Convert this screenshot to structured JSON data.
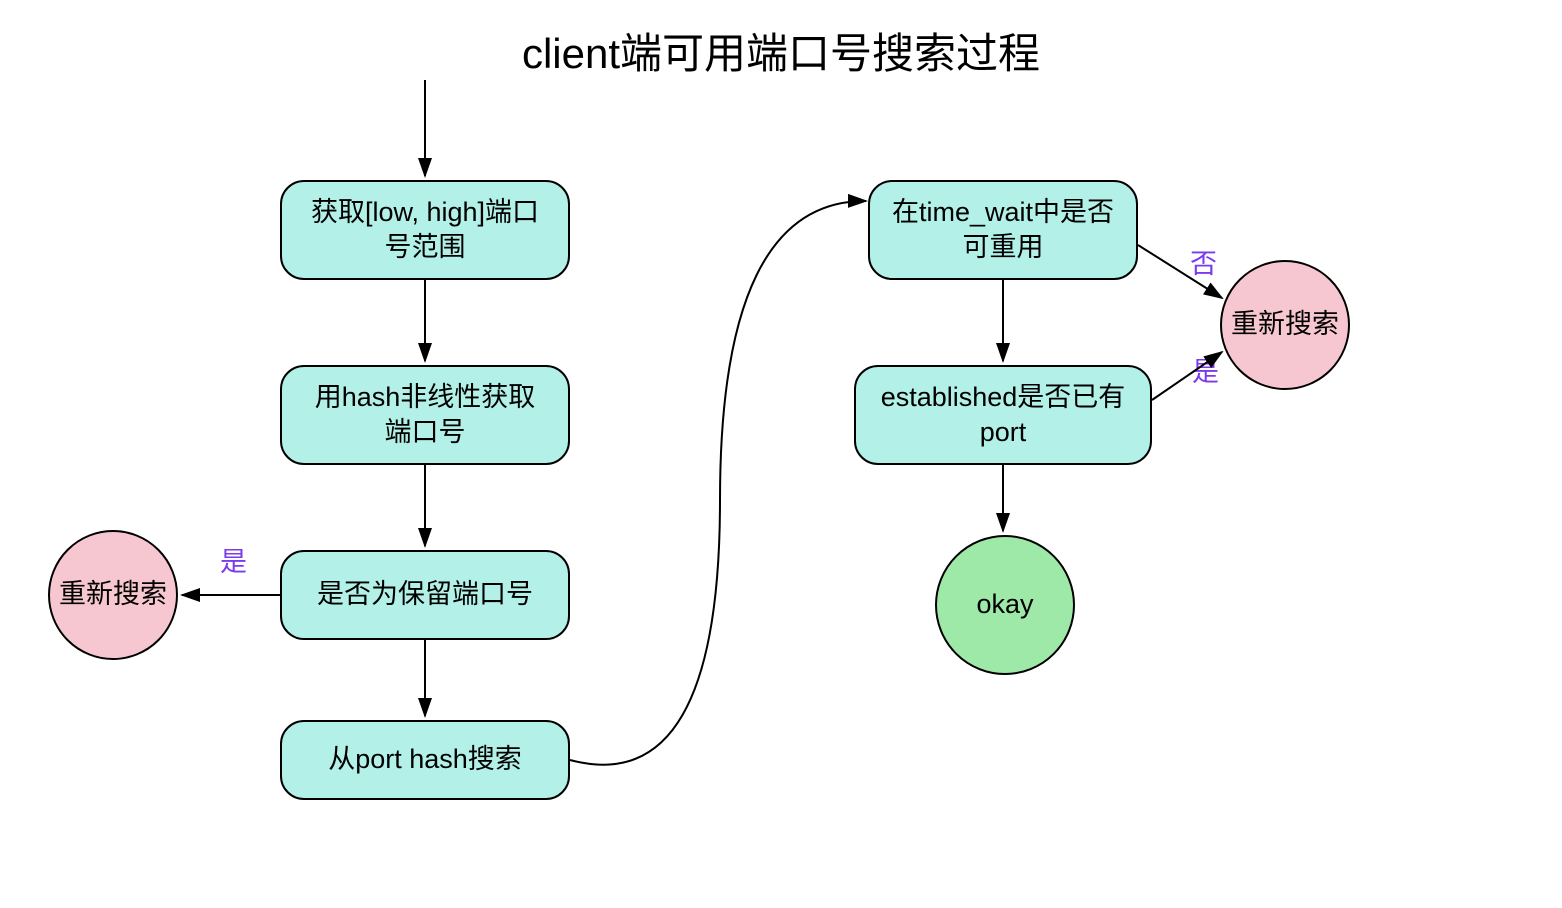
{
  "diagram": {
    "title": "client端可用端口号搜索过程",
    "nodes": {
      "box1": "获取[low, high]端口号范围",
      "box2": "用hash非线性获取端口号",
      "box3": "是否为保留端口号",
      "box4": "从port hash搜索",
      "box5": "在time_wait中是否可重用",
      "box6": "established是否已有port",
      "circle_left": "重新搜索",
      "circle_right": "重新搜索",
      "circle_okay": "okay"
    },
    "edge_labels": {
      "yes_left": "是",
      "no_right": "否",
      "yes_right": "是"
    }
  }
}
